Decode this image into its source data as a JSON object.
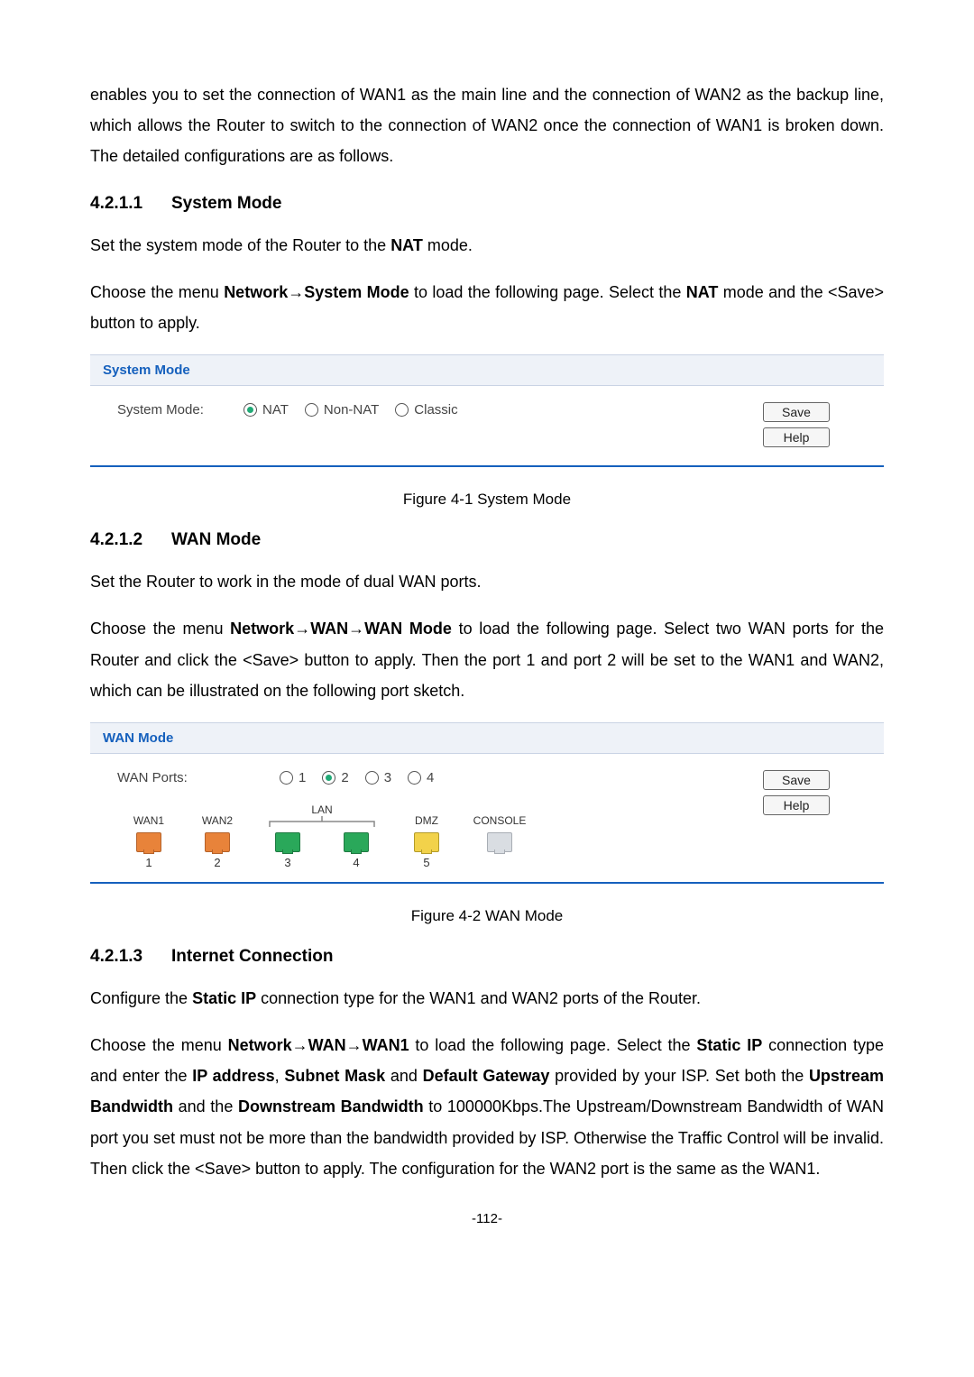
{
  "para1": "enables you to set the connection of WAN1 as the main line and the connection of WAN2 as the backup line, which allows the Router to switch to the connection of WAN2 once the connection of WAN1 is broken down. The detailed configurations are as follows.",
  "section1": {
    "num": "4.2.1.1",
    "title": "System Mode"
  },
  "para2_a": "Set the system mode of the Router to the ",
  "para2_b": "NAT",
  "para2_c": " mode.",
  "para3_a": "Choose the menu ",
  "para3_b": "Network→System Mode",
  "para3_c": " to load the following page. Select the ",
  "para3_d": "NAT",
  "para3_e": " mode and the <Save> button to apply.",
  "panel_sysmode": {
    "title": "System Mode",
    "label": "System Mode:",
    "options": [
      {
        "label": "NAT",
        "selected": true
      },
      {
        "label": "Non-NAT",
        "selected": false
      },
      {
        "label": "Classic",
        "selected": false
      }
    ],
    "buttons": {
      "save": "Save",
      "help": "Help"
    }
  },
  "caption1": "Figure 4-1 System Mode",
  "section2": {
    "num": "4.2.1.2",
    "title": "WAN Mode"
  },
  "para4": "Set the Router to work in the mode of dual WAN ports.",
  "para5_a": "Choose the menu ",
  "para5_b": "Network→WAN→WAN Mode",
  "para5_c": " to load the following page. Select two WAN ports for the Router and click the <Save> button to apply. Then the port 1 and port 2 will be set to the WAN1 and WAN2, which can be illustrated on the following port sketch.",
  "panel_wanmode": {
    "title": "WAN Mode",
    "label": "WAN Ports:",
    "options": [
      {
        "label": "1",
        "selected": false
      },
      {
        "label": "2",
        "selected": true
      },
      {
        "label": "3",
        "selected": false
      },
      {
        "label": "4",
        "selected": false
      }
    ],
    "ports": {
      "p1": {
        "top": "WAN1",
        "num": "1"
      },
      "p2": {
        "top": "WAN2",
        "num": "2"
      },
      "lan_label": "LAN",
      "p3": {
        "num": "3"
      },
      "p4": {
        "num": "4"
      },
      "p5": {
        "top": "DMZ",
        "num": "5"
      },
      "console": "CONSOLE"
    },
    "buttons": {
      "save": "Save",
      "help": "Help"
    }
  },
  "caption2": "Figure 4-2 WAN Mode",
  "section3": {
    "num": "4.2.1.3",
    "title": "Internet Connection"
  },
  "para6_a": "Configure the ",
  "para6_b": "Static IP",
  "para6_c": " connection type for the WAN1 and WAN2 ports of the Router.",
  "para7_a": "Choose the menu ",
  "para7_b": "Network→WAN→WAN1",
  "para7_c": " to load the following page. Select the ",
  "para7_d": "Static IP",
  "para7_e": " connection type and enter the ",
  "para7_f": "IP address",
  "para7_g": ", ",
  "para7_h": "Subnet Mask",
  "para7_i": " and ",
  "para7_j": "Default Gateway",
  "para7_k": " provided by your ISP. Set both the ",
  "para7_l": "Upstream Bandwidth",
  "para7_m": " and the ",
  "para7_n": "Downstream Bandwidth",
  "para7_o": " to 100000Kbps.The Upstream/Downstream Bandwidth of WAN port you set must not be more than the bandwidth provided by ISP. Otherwise the Traffic Control will be invalid. Then click the <Save> button to apply. The configuration for the WAN2 port is the same as the WAN1.",
  "page_number": "-112-"
}
